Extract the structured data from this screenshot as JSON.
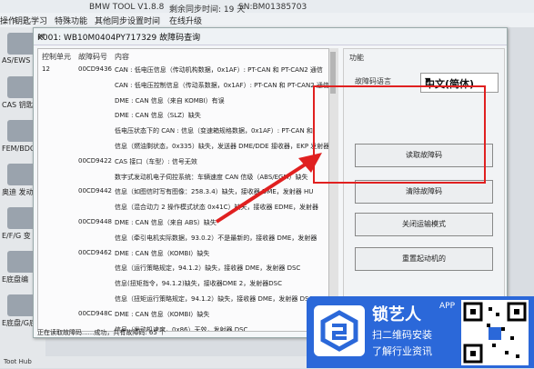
{
  "topbar": {
    "app_title": "BMW TOOL V1.8.8",
    "remaining": "剩余同步时间: 19 天",
    "sn": "SN:BM01385703"
  },
  "menu": [
    "操作",
    "钥匙学习",
    "特殊功能",
    "其他",
    "同步设置时间",
    "在线升级"
  ],
  "left_panel": {
    "items": [
      "AS/EWS 8",
      "CAS 钥匙",
      "FEM/BDC 钥",
      "奥迪 发动",
      "E/F/G 变",
      "E底盘编",
      "E底盘/G底盘",
      "Hub"
    ]
  },
  "bottombar": {
    "label": "Toot Hub"
  },
  "dialog": {
    "title": "K001: WB10M0404PY717329 故障码查询",
    "close": "✕",
    "columns": [
      "控制单元",
      "故障码号",
      "内容"
    ],
    "rows": [
      {
        "unit": "12",
        "code": "00CD9436",
        "text": "CAN : 低电压信息（传动机构数据，0x1AF）: PT-CAN 和 PT-CAN2 通信"
      },
      {
        "unit": "",
        "code": "",
        "text": "CAN : 低电压控制信息（传动系数据，0x1AF）: PT-CAN 和 PT-CAN2 通信"
      },
      {
        "unit": "",
        "code": "",
        "text": "DME : CAN 信息（来自 KOMBI）有误"
      },
      {
        "unit": "",
        "code": "",
        "text": "DME : CAN 信息（SLZ）缺失"
      },
      {
        "unit": "",
        "code": "",
        "text": "低电压状态下的 CAN : 信息（变速箱规格数据，0x1AF）: PT-CAN 和"
      },
      {
        "unit": "",
        "code": "",
        "text": "信息（燃油剩状态，0x335）缺失，发送器 DME/DDE 接收器，EKP 发射器"
      },
      {
        "unit": "",
        "code": "00CD9422",
        "text": "CAS 接口（车型）: 信号无效"
      },
      {
        "unit": "",
        "code": "",
        "text": "数字式发动机电子伺控系统：车辆速度 CAN 信级（ABS/EGM）缺失"
      },
      {
        "unit": "",
        "code": "00CD9442",
        "text": "信息（如图信时写有图像：258.3.4）缺失，接收器 DME，发射器 HU"
      },
      {
        "unit": "",
        "code": "",
        "text": "信息（混合动力 2 操作模式状态 0x41C）缺失，接收器 EDME，发射器"
      },
      {
        "unit": "",
        "code": "00CD9448",
        "text": "DME : CAN 信息（来自 ABS）缺失"
      },
      {
        "unit": "",
        "code": "",
        "text": "信息（牵引电机实际数据，93.0.2）不是最新的，接收器 DME，发射器"
      },
      {
        "unit": "",
        "code": "00CD9462",
        "text": "DME : CAN 信息（KOMBI）缺失"
      },
      {
        "unit": "",
        "code": "",
        "text": "信息（运行策略规定，94.1.2）缺失，接收器 DME，发射器 DSC"
      },
      {
        "unit": "",
        "code": "",
        "text": "信息(扭矩指令，94.1.2)缺失，接收器DME 2，发射器DSC"
      },
      {
        "unit": "",
        "code": "",
        "text": "信息（扭矩运行策略规定，94.1.2）缺失，接收器 DME，发射器 DSC"
      },
      {
        "unit": "",
        "code": "00CD948C",
        "text": "DME : CAN 信息（KOMBI）缺失"
      },
      {
        "unit": "",
        "code": "",
        "text": "信号（发动机速度，0x86）无效，发射器 DSC"
      }
    ],
    "status": "正在读取故障码......成功，共有故障码: 65 个",
    "function_panel": {
      "title": "功能",
      "lang_label": "故障码语言",
      "lang_value": "中文(简体)",
      "buttons": [
        "读取故障码",
        "清除故障码",
        "关闭运输模式",
        "重置起动机的"
      ]
    }
  },
  "ad": {
    "title": "锁艺人",
    "app": "APP",
    "line1": "扫二维码安装",
    "line2": "了解行业资讯"
  },
  "colors": {
    "highlight": "#e02020",
    "ad_bg": "#2b68d9"
  }
}
